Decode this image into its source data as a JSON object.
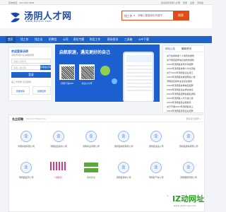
{
  "topbar": {
    "hotline": "咨询电话：400-630-1888",
    "links": [
      "欢迎来到汤阴人才网",
      "登录",
      "注册",
      "手机版"
    ]
  },
  "header": {
    "logo_text": "汤阴人才网",
    "logo_sub": "www.aytyrc.com",
    "search": {
      "select_label": "找工作",
      "placeholder": "请输入要搜索的关键字",
      "button_label": "搜索"
    }
  },
  "nav": {
    "items": [
      "首页",
      "找工作",
      "找企业",
      "招聘会",
      "公司",
      "职位专题",
      "附近工作",
      "职场资讯",
      "工具箱",
      "APP下载"
    ]
  },
  "login": {
    "title": "欢迎登录汤阴",
    "subtitle": "手机号/用户名/邮箱登录",
    "phone_placeholder": "请输入手机号",
    "code_placeholder": "请输入验证码",
    "code_button": "获取验证码",
    "login_button": "登录",
    "small": "第三方登录 忘记密码",
    "quick": [
      "我要求职",
      "我要招聘"
    ]
  },
  "banner": {
    "headline": "启航职涯，遇见更好的自己",
    "qr_labels": [
      "扫码下载APP",
      "关注公众号"
    ]
  },
  "news": {
    "tabs": [
      "网站公告",
      "最新资讯"
    ],
    "items": [
      "关于启用新版个人简历的通知",
      "关于规范招聘信息发布的通知",
      "2024年汤阴县春风行动招聘",
      "2024年汤阴县春季人才交流会",
      "关于2024年汤阴县企业用工",
      "2024年汤阴县秋季招聘会公告",
      "汤阴县高校毕业生就业服务",
      "2024年汤阴县春季校园招聘",
      "2024年汤阴县企业岗位信息",
      "2024年汤阴县招聘会报名通知",
      "2024年汤阴县人才引进公告",
      "2024年汤阴县就业援助月",
      "关于开展2024年汤阴县线上",
      "2024年汤阴县民营企业招聘"
    ]
  },
  "company": {
    "title": "名企招聘",
    "en": "Famous Enterprise",
    "more": "更多名企招聘 >",
    "cards": [
      "河南科技有限公司",
      "汤阴县自来水公司",
      "汤阴商业有限公司",
      "汤阴县物流有限公司",
      "汤阴县食品公司",
      "汤阴县钢铁有限公司",
      "汤阴县医药公司",
      "川越鞋子",
      "森成快递",
      "汤阴县建材公司",
      "汤阴县汽车公司",
      "汤阴服装有限公司"
    ]
  },
  "watermark": {
    "cloud": "Ai",
    "big": "IZ动网址",
    "sub": "www.aizdong.com"
  },
  "colors": {
    "brand": "#1f62c9",
    "search_accent": "#e04b16",
    "watermark_green": "#27a11e"
  }
}
